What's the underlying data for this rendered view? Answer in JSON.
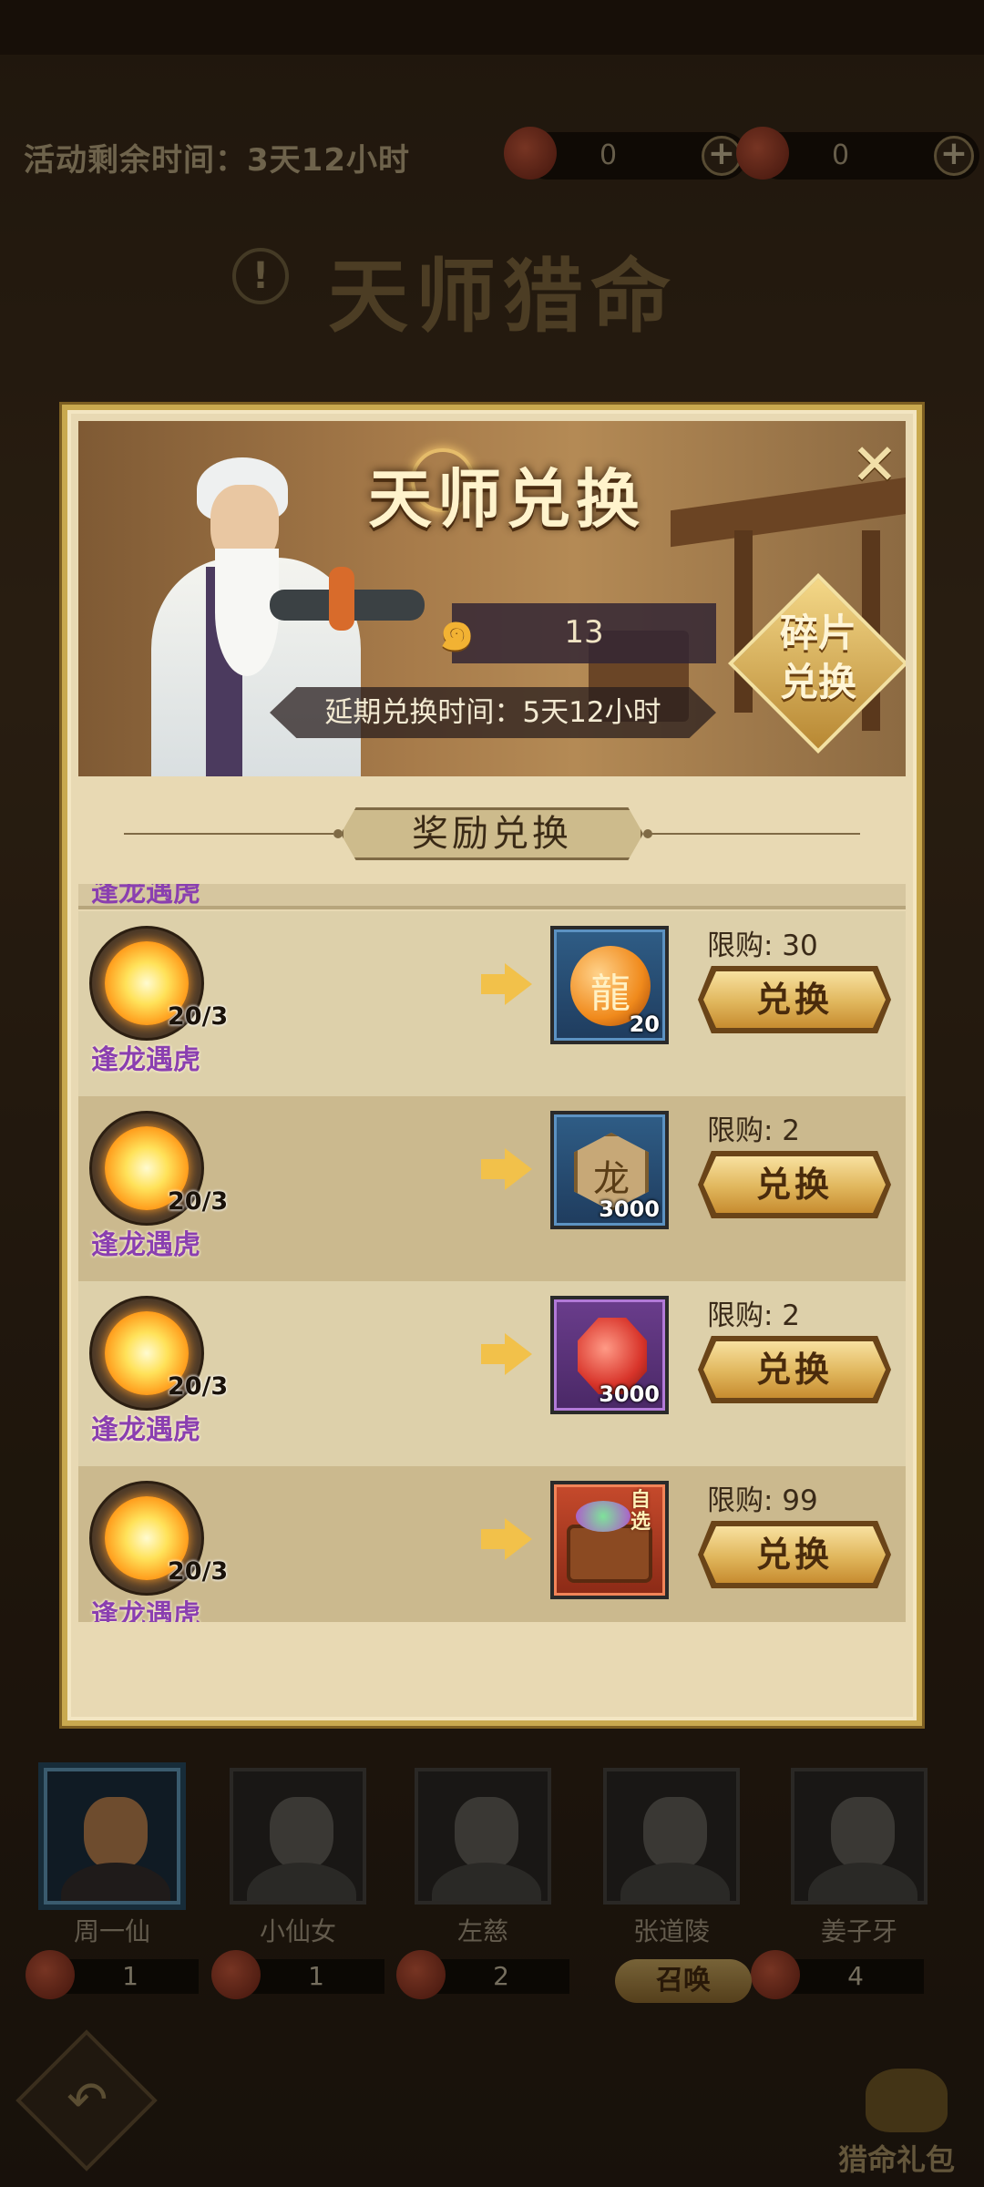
{
  "background": {
    "activity_time": "活动剩余时间：3天12小时",
    "counters": [
      {
        "icon": "red-charm-icon",
        "value": "0"
      },
      {
        "icon": "red-mask-icon",
        "value": "0"
      }
    ],
    "title": "天师猎命",
    "info_icon": "info-icon",
    "characters": [
      {
        "name": "周一仙",
        "count": "1"
      },
      {
        "name": "小仙女",
        "count": "1"
      },
      {
        "name": "左慈",
        "count": "2"
      },
      {
        "name": "张道陵",
        "count": ""
      },
      {
        "name": "姜子牙",
        "count": "4"
      }
    ],
    "summon_label": "召唤",
    "gift_label": "猎命礼包"
  },
  "modal": {
    "title": "天师兑换",
    "close_icon": "close-icon",
    "fragment_count": "13",
    "extend_time": "延期兑换时间：5天12小时",
    "fragment_exchange_label": "碎片\n兑换",
    "section_title": "奖励兑换",
    "clipped_row_name": "逢龙遇虎",
    "rows": [
      {
        "cost_name": "逢龙遇虎",
        "cost_count": "20/3",
        "reward_icon": "dragon-orb-icon",
        "reward_qty": "20",
        "reward_frame": "blue",
        "limit": "限购: 30",
        "button": "兑换"
      },
      {
        "cost_name": "逢龙遇虎",
        "cost_count": "20/3",
        "reward_icon": "coin-icon",
        "reward_qty": "3000",
        "reward_frame": "blue",
        "limit": "限购: 2",
        "button": "兑换"
      },
      {
        "cost_name": "逢龙遇虎",
        "cost_count": "20/3",
        "reward_icon": "red-gem-icon",
        "reward_qty": "3000",
        "reward_frame": "purple",
        "limit": "限购: 2",
        "button": "兑换"
      },
      {
        "cost_name": "逢龙遇虎",
        "cost_count": "20/3",
        "reward_icon": "treasure-chest-icon",
        "reward_qty": "",
        "reward_tag": "自选",
        "reward_frame": "red",
        "limit": "限购: 99",
        "button": "兑换"
      }
    ]
  },
  "colors": {
    "accent_gold": "#c9a94f",
    "name_purple": "#8a3fb0",
    "button_gold": "#e0b65c"
  }
}
